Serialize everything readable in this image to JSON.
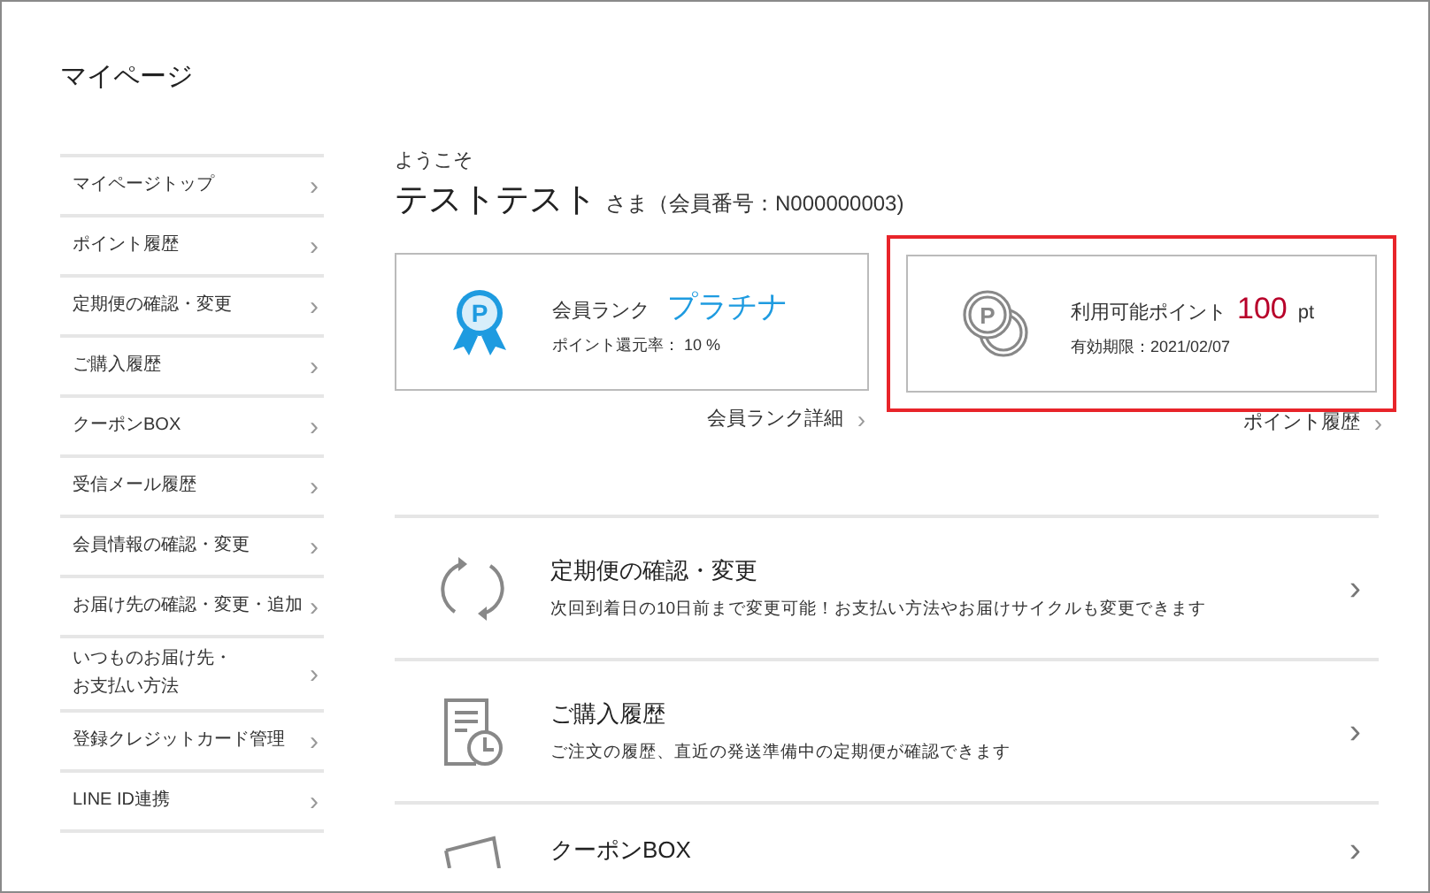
{
  "page_title": "マイページ",
  "sidebar": {
    "items": [
      {
        "label": "マイページトップ",
        "chevron": "›"
      },
      {
        "label": "ポイント履歴",
        "chevron": "›"
      },
      {
        "label": "定期便の確認・変更",
        "chevron": "›"
      },
      {
        "label": "ご購入履歴",
        "chevron": "›"
      },
      {
        "label": "クーポンBOX",
        "chevron": "›"
      },
      {
        "label": "受信メール履歴",
        "chevron": "›"
      },
      {
        "label": "会員情報の確認・変更",
        "chevron": "›"
      },
      {
        "label": "お届け先の確認・変更・追加",
        "chevron": "›"
      },
      {
        "lines": [
          "いつものお届け先・",
          "お支払い方法"
        ],
        "chevron": "›"
      },
      {
        "label": "登録クレジットカード管理",
        "chevron": "›"
      },
      {
        "label": "LINE ID連携",
        "chevron": "›"
      }
    ]
  },
  "welcome": {
    "greeting": "ようこそ",
    "name": "テストテスト",
    "suffix": "さま（会員番号：N000000003)"
  },
  "rank_card": {
    "badge_letter": "P",
    "label": "会員ランク",
    "rank": "プラチナ",
    "rate": "ポイント還元率： 10 %",
    "link": "会員ランク詳細",
    "chevron": "›"
  },
  "points_card": {
    "highlighted": true,
    "coin_letter": "P",
    "label": "利用可能ポイント",
    "value": "100",
    "unit": "pt",
    "expiry": "有効期限：2021/02/07",
    "link": "ポイント履歴",
    "chevron": "›"
  },
  "menu": [
    {
      "kind": "subscription",
      "title": "定期便の確認・変更",
      "description": "次回到着日の10日前まで変更可能！お支払い方法やお届けサイクルも変更できます",
      "chevron": "›"
    },
    {
      "kind": "history",
      "title": "ご購入履歴",
      "description": "ご注文の履歴、直近の発送準備中の定期便が確認できます",
      "chevron": "›"
    },
    {
      "kind": "coupon",
      "title": "クーポンBOX",
      "chevron": "›"
    }
  ]
}
